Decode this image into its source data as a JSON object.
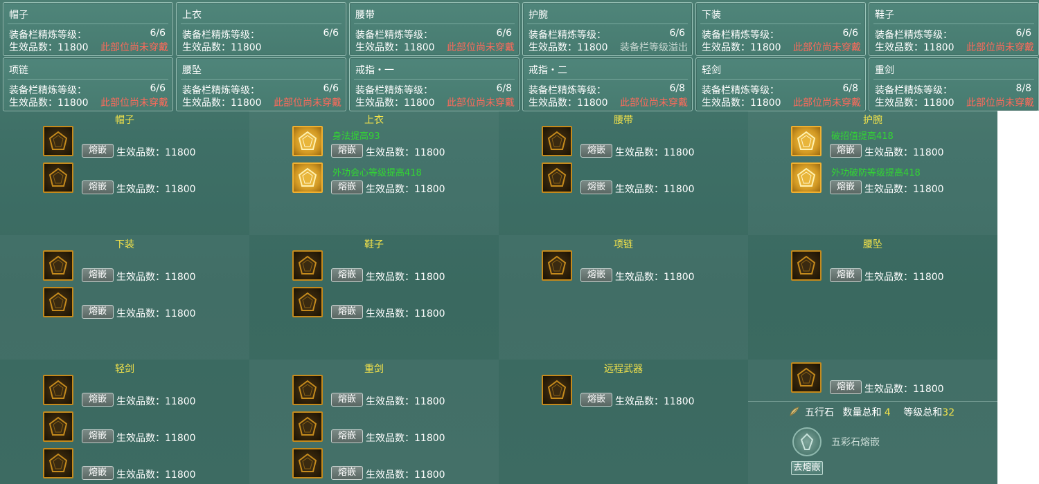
{
  "common": {
    "level_label": "装备栏精炼等级：",
    "effect_label": "生效品数：11800",
    "embed_button": "熔嵌"
  },
  "panels": [
    {
      "title": "帽子",
      "level": "6/6",
      "note": "此部位尚未穿戴",
      "note_style": "red"
    },
    {
      "title": "上衣",
      "level": "6/6",
      "note": "",
      "note_style": "red"
    },
    {
      "title": "腰带",
      "level": "6/6",
      "note": "此部位尚未穿戴",
      "note_style": "red"
    },
    {
      "title": "护腕",
      "level": "6/6",
      "note": "装备栏等级溢出",
      "note_style": "grey"
    },
    {
      "title": "下装",
      "level": "6/6",
      "note": "此部位尚未穿戴",
      "note_style": "red"
    },
    {
      "title": "鞋子",
      "level": "6/6",
      "note": "此部位尚未穿戴",
      "note_style": "red"
    },
    {
      "title": "项链",
      "level": "6/6",
      "note": "此部位尚未穿戴",
      "note_style": "red"
    },
    {
      "title": "腰坠",
      "level": "6/6",
      "note": "此部位尚未穿戴",
      "note_style": "red"
    },
    {
      "title": "戒指・一",
      "level": "6/8",
      "note": "此部位尚未穿戴",
      "note_style": "red"
    },
    {
      "title": "戒指・二",
      "level": "6/8",
      "note": "此部位尚未穿戴",
      "note_style": "red"
    },
    {
      "title": "轻剑",
      "level": "6/8",
      "note": "此部位尚未穿戴",
      "note_style": "red"
    },
    {
      "title": "重剑",
      "level": "8/8",
      "note": "此部位尚未穿戴",
      "note_style": "red"
    }
  ],
  "sections": [
    {
      "title": "帽子",
      "slots": [
        {
          "lit": false,
          "attr": ""
        },
        {
          "lit": false,
          "attr": ""
        }
      ]
    },
    {
      "title": "上衣",
      "slots": [
        {
          "lit": true,
          "attr": "身法提高93"
        },
        {
          "lit": true,
          "attr": "外功会心等级提高418"
        }
      ]
    },
    {
      "title": "腰带",
      "slots": [
        {
          "lit": false,
          "attr": ""
        },
        {
          "lit": false,
          "attr": ""
        }
      ]
    },
    {
      "title": "护腕",
      "slots": [
        {
          "lit": true,
          "attr": "破招值提高418"
        },
        {
          "lit": true,
          "attr": "外功破防等级提高418"
        }
      ]
    },
    {
      "title": "下装",
      "slots": [
        {
          "lit": false,
          "attr": ""
        },
        {
          "lit": false,
          "attr": ""
        }
      ]
    },
    {
      "title": "鞋子",
      "slots": [
        {
          "lit": false,
          "attr": ""
        },
        {
          "lit": false,
          "attr": ""
        }
      ]
    },
    {
      "title": "项链",
      "slots": [
        {
          "lit": false,
          "attr": ""
        }
      ]
    },
    {
      "title": "腰坠",
      "slots": [
        {
          "lit": false,
          "attr": ""
        }
      ]
    },
    {
      "title": "轻剑",
      "slots": [
        {
          "lit": false,
          "attr": ""
        },
        {
          "lit": false,
          "attr": ""
        },
        {
          "lit": false,
          "attr": ""
        }
      ]
    },
    {
      "title": "重剑",
      "slots": [
        {
          "lit": false,
          "attr": ""
        },
        {
          "lit": false,
          "attr": ""
        },
        {
          "lit": false,
          "attr": ""
        }
      ]
    },
    {
      "title": "远程武器",
      "slots": [
        {
          "lit": false,
          "attr": ""
        }
      ]
    },
    {
      "title": "",
      "slots": [
        {
          "lit": false,
          "attr": ""
        }
      ]
    }
  ],
  "summary": {
    "stone_label": "五行石",
    "count_label": "数量总和",
    "count_value": "4",
    "level_label": "等级总和",
    "level_value": "32"
  },
  "colorful_stone": {
    "label": "五彩石熔嵌",
    "button": "去熔嵌"
  },
  "colors": {
    "section_title": "#f5e44a",
    "attr_green": "#32d832",
    "warning_red": "#ff6a5a"
  }
}
